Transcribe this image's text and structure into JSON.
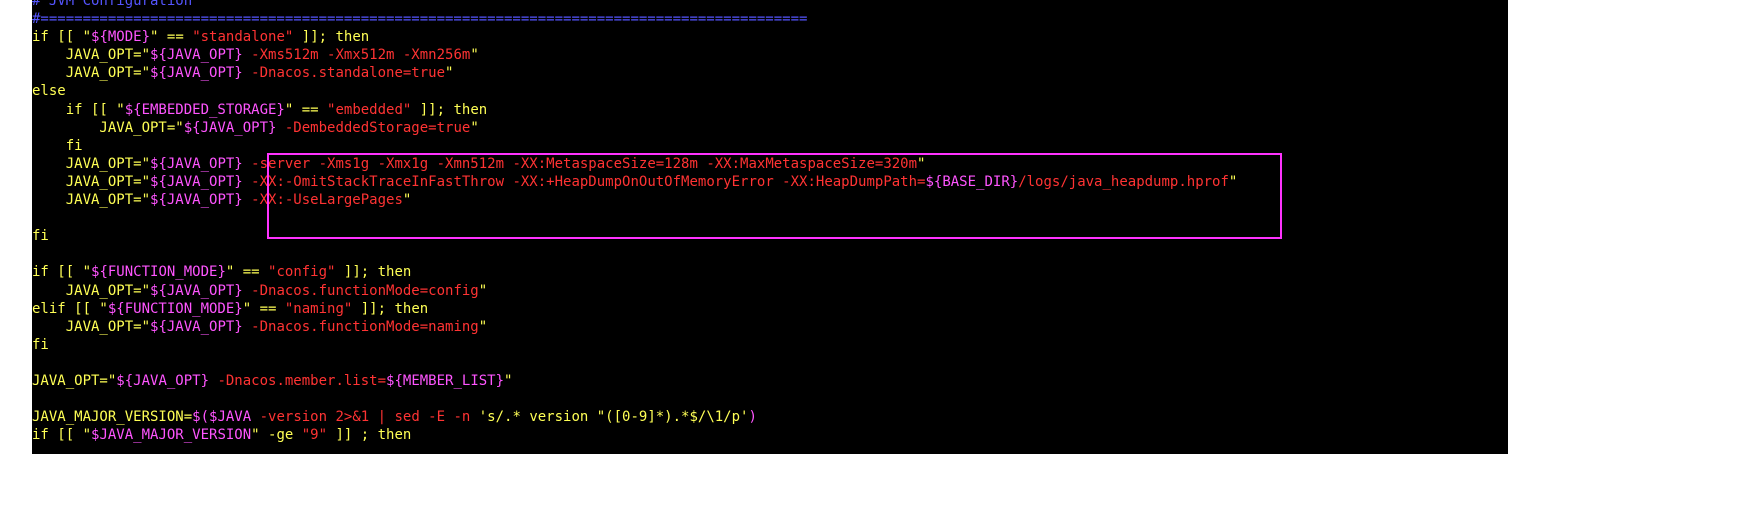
{
  "colors": {
    "background": "#000000",
    "keyword": "#ffff55",
    "variable": "#ff55ff",
    "string": "#ff3333",
    "comment": "#5555ff",
    "highlight_box": "#ff33ff"
  },
  "terminal": {
    "lines": [
      [
        [
          "comment",
          "# JVM Configuration"
        ]
      ],
      [
        [
          "comment",
          "#==========================================================================================="
        ]
      ],
      [
        [
          "keyword",
          "if [[ \""
        ],
        [
          "variable",
          "${MODE}"
        ],
        [
          "keyword",
          "\" == "
        ],
        [
          "string",
          "\"standalone\""
        ],
        [
          "keyword",
          " ]]; then"
        ]
      ],
      [
        [
          "keyword",
          "    JAVA_OPT=\""
        ],
        [
          "variable",
          "${JAVA_OPT}"
        ],
        [
          "string",
          " -Xms512m -Xmx512m -Xmn256m"
        ],
        [
          "keyword",
          "\""
        ]
      ],
      [
        [
          "keyword",
          "    JAVA_OPT=\""
        ],
        [
          "variable",
          "${JAVA_OPT}"
        ],
        [
          "string",
          " -Dnacos.standalone=true"
        ],
        [
          "keyword",
          "\""
        ]
      ],
      [
        [
          "keyword",
          "else"
        ]
      ],
      [
        [
          "keyword",
          "    if [[ \""
        ],
        [
          "variable",
          "${EMBEDDED_STORAGE}"
        ],
        [
          "keyword",
          "\" == "
        ],
        [
          "string",
          "\"embedded\""
        ],
        [
          "keyword",
          " ]]; then"
        ]
      ],
      [
        [
          "keyword",
          "        JAVA_OPT=\""
        ],
        [
          "variable",
          "${JAVA_OPT}"
        ],
        [
          "string",
          " -DembeddedStorage=true"
        ],
        [
          "keyword",
          "\""
        ]
      ],
      [
        [
          "keyword",
          "    fi"
        ]
      ],
      [
        [
          "keyword",
          "    JAVA_OPT=\""
        ],
        [
          "variable",
          "${JAVA_OPT}"
        ],
        [
          "string",
          " -server -Xms1g -Xmx1g -Xmn512m -XX:MetaspaceSize=128m -XX:MaxMetaspaceSize=320m"
        ],
        [
          "keyword",
          "\""
        ]
      ],
      [
        [
          "keyword",
          "    JAVA_OPT=\""
        ],
        [
          "variable",
          "${JAVA_OPT}"
        ],
        [
          "string",
          " -XX:-OmitStackTraceInFastThrow -XX:+HeapDumpOnOutOfMemoryError -XX:HeapDumpPath="
        ],
        [
          "variable",
          "${BASE_DIR}"
        ],
        [
          "string",
          "/logs/java_heapdump.hprof"
        ],
        [
          "keyword",
          "\""
        ]
      ],
      [
        [
          "keyword",
          "    JAVA_OPT=\""
        ],
        [
          "variable",
          "${JAVA_OPT}"
        ],
        [
          "string",
          " -XX:-UseLargePages"
        ],
        [
          "keyword",
          "\""
        ]
      ],
      [
        [
          "keyword",
          ""
        ]
      ],
      [
        [
          "keyword",
          "fi"
        ]
      ],
      [
        [
          "keyword",
          ""
        ]
      ],
      [
        [
          "keyword",
          "if [[ \""
        ],
        [
          "variable",
          "${FUNCTION_MODE}"
        ],
        [
          "keyword",
          "\" == "
        ],
        [
          "string",
          "\"config\""
        ],
        [
          "keyword",
          " ]]; then"
        ]
      ],
      [
        [
          "keyword",
          "    JAVA_OPT=\""
        ],
        [
          "variable",
          "${JAVA_OPT}"
        ],
        [
          "string",
          " -Dnacos.functionMode=config"
        ],
        [
          "keyword",
          "\""
        ]
      ],
      [
        [
          "keyword",
          "elif [[ \""
        ],
        [
          "variable",
          "${FUNCTION_MODE}"
        ],
        [
          "keyword",
          "\" == "
        ],
        [
          "string",
          "\"naming\""
        ],
        [
          "keyword",
          " ]]; then"
        ]
      ],
      [
        [
          "keyword",
          "    JAVA_OPT=\""
        ],
        [
          "variable",
          "${JAVA_OPT}"
        ],
        [
          "string",
          " -Dnacos.functionMode=naming"
        ],
        [
          "keyword",
          "\""
        ]
      ],
      [
        [
          "keyword",
          "fi"
        ]
      ],
      [
        [
          "keyword",
          ""
        ]
      ],
      [
        [
          "keyword",
          "JAVA_OPT=\""
        ],
        [
          "variable",
          "${JAVA_OPT}"
        ],
        [
          "string",
          " -Dnacos.member.list="
        ],
        [
          "variable",
          "${MEMBER_LIST}"
        ],
        [
          "keyword",
          "\""
        ]
      ],
      [
        [
          "keyword",
          ""
        ]
      ],
      [
        [
          "keyword",
          "JAVA_MAJOR_VERSION="
        ],
        [
          "variable",
          "$($JAVA"
        ],
        [
          "string",
          " -version 2>&1 | sed -E -n "
        ],
        [
          "keyword",
          "'s/.* version \"([0-9]*).*$/\\1/p'"
        ],
        [
          "variable",
          ")"
        ]
      ],
      [
        [
          "keyword",
          "if [[ \""
        ],
        [
          "variable",
          "$JAVA_MAJOR_VERSION"
        ],
        [
          "keyword",
          "\" -ge "
        ],
        [
          "string",
          "\"9\""
        ],
        [
          "keyword",
          " ]] ; then"
        ]
      ]
    ]
  }
}
